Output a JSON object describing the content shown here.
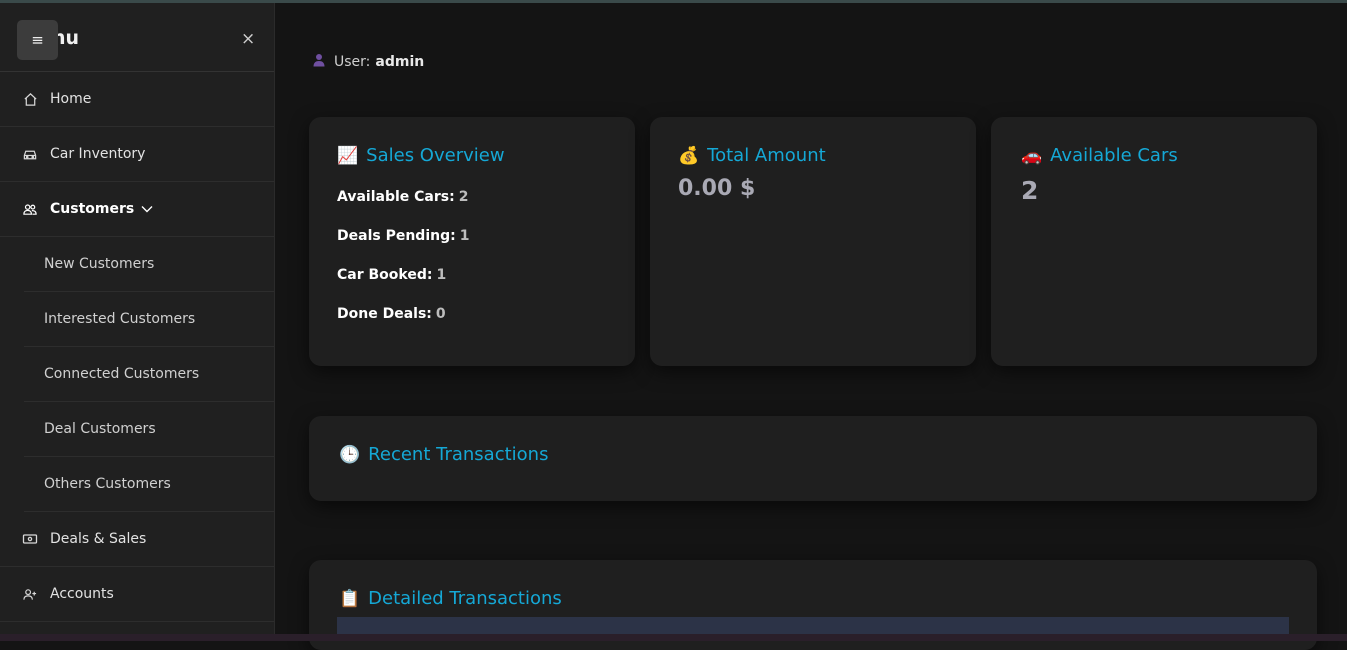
{
  "sidebar": {
    "title": "nu",
    "hamburger": "≡",
    "close": "×",
    "items": [
      {
        "label": "Home",
        "icon": "home-icon"
      },
      {
        "label": "Car Inventory",
        "icon": "car-icon"
      },
      {
        "label": "Customers",
        "icon": "users-icon"
      },
      {
        "label": "Deals & Sales",
        "icon": "cash-icon"
      },
      {
        "label": "Accounts",
        "icon": "user-plus-icon"
      }
    ],
    "customer_subitems": [
      "New Customers",
      "Interested Customers",
      "Connected Customers",
      "Deal Customers",
      "Others Customers"
    ]
  },
  "user": {
    "prefix": "User:",
    "name": "admin"
  },
  "cards": {
    "sales_overview": {
      "emoji": "📈",
      "title": "Sales Overview",
      "stats": [
        {
          "label": "Available Cars:",
          "value": "2"
        },
        {
          "label": "Deals Pending:",
          "value": "1"
        },
        {
          "label": "Car Booked:",
          "value": "1"
        },
        {
          "label": "Done Deals:",
          "value": "0"
        }
      ]
    },
    "total_amount": {
      "emoji": "💰",
      "title": "Total Amount",
      "value": "0.00 $"
    },
    "available_cars": {
      "emoji": "🚗",
      "title": "Available Cars",
      "value": "2"
    },
    "recent_transactions": {
      "emoji": "🕒",
      "title": "Recent Transactions"
    },
    "detailed_transactions": {
      "emoji": "📋",
      "title": "Detailed Transactions"
    }
  },
  "colors": {
    "accent": "#15a8d6",
    "card_bg": "#1f1f1f",
    "sidebar_bg": "#202020"
  }
}
